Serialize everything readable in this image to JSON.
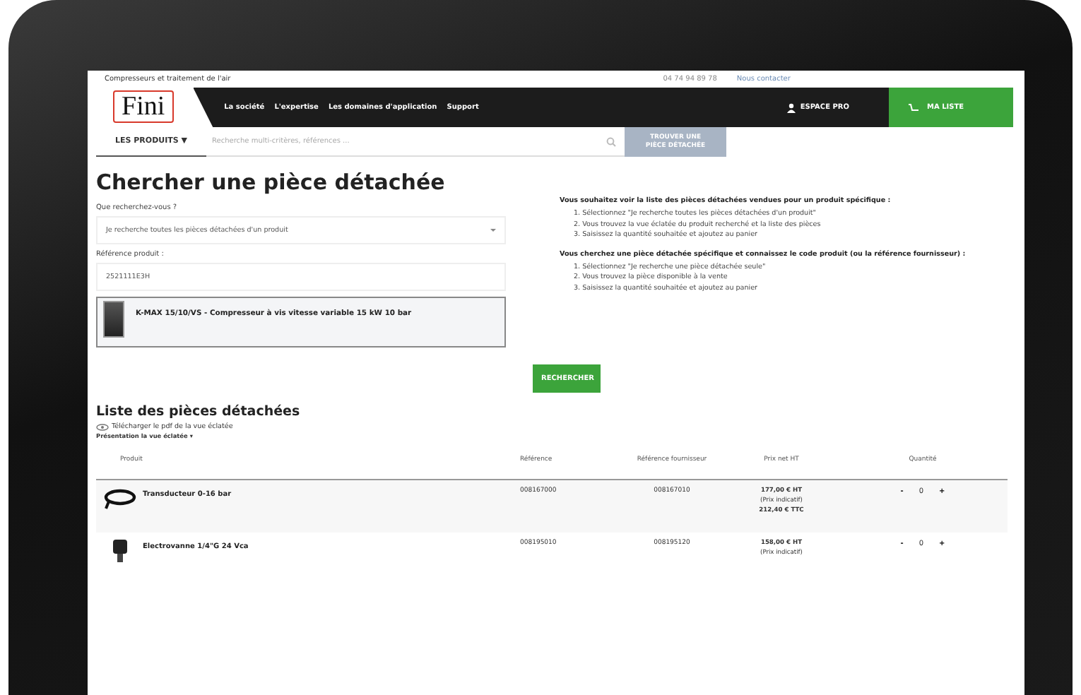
{
  "top_bar": {
    "tagline": "Compresseurs et traitement de l'air",
    "phone": "04 74 94 89 78",
    "contact": "Nous contacter"
  },
  "logo": "Fini",
  "nav": {
    "items": [
      "La société",
      "L'expertise",
      "Les domaines d'application",
      "Support"
    ],
    "account": "ESPACE PRO",
    "cart": "MA LISTE"
  },
  "search_bar": {
    "menu": "LES PRODUITS ▼",
    "placeholder": "Recherche multi-critères, références ...",
    "button": "TROUVER UNE PIÈCE DÉTACHÉE"
  },
  "title": "Chercher une pièce détachée",
  "fields": [
    {
      "kind": "select",
      "label": "Que recherchez-vous ?",
      "value": "Je recherche toutes les pièces détachées d'un produit"
    },
    {
      "kind": "input",
      "label": "Référence produit :",
      "value": "2521111E3H"
    }
  ],
  "suggestion": "K-MAX 15/10/VS - Compresseur à vis vitesse variable 15 kW 10 bar",
  "search_button": "RECHERCHER",
  "help": [
    {
      "heading": "Vous souhaitez voir la liste des pièces détachées vendues pour un produit spécifique :",
      "steps": [
        "1. Sélectionnez \"Je recherche toutes les pièces détachées d'un produit\"",
        "2. Vous trouvez la vue éclatée du produit recherché et la liste des pièces",
        "3. Saisissez la quantité souhaitée et ajoutez au panier"
      ]
    },
    {
      "heading": "Vous cherchez une pièce détachée spécifique et connaissez le code produit (ou la référence fournisseur) :",
      "steps": [
        "1. Sélectionnez \"Je recherche une pièce détachée seule\"",
        "2. Vous trouvez la pièce disponible à la vente",
        "3. Saisissez la quantité souhaitée et ajoutez au panier"
      ]
    }
  ],
  "parts": {
    "title": "Liste des pièces détachées",
    "download": "Télécharger le pdf de la vue éclatée",
    "note": "Présentation la vue éclatée ▾",
    "columns": [
      "Produit",
      "Référence",
      "Référence fournisseur",
      "Prix net HT",
      "Quantité"
    ],
    "rows": [
      {
        "product": "Transducteur 0-16 bar",
        "reference": "008167000",
        "supplier_ref": "008167010",
        "prices": [
          "177,00 € HT",
          "(Prix indicatif)",
          "212,40 € TTC"
        ],
        "minus": "-",
        "quantity": "0",
        "plus": "+"
      },
      {
        "product": "Electrovanne 1/4\"G 24 Vca",
        "reference": "008195010",
        "supplier_ref": "008195120",
        "prices": [
          "158,00 € HT",
          "(Prix indicatif)"
        ],
        "minus": "-",
        "quantity": "0",
        "plus": "+"
      }
    ]
  }
}
